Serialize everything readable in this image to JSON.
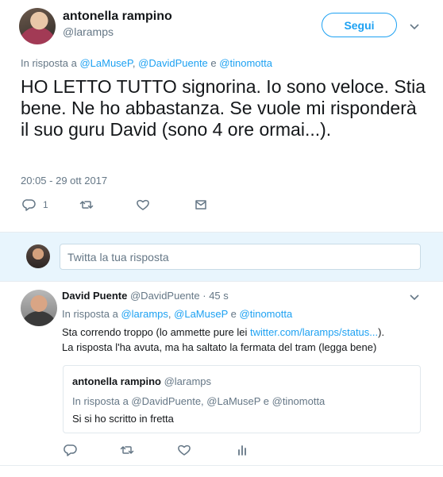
{
  "main_tweet": {
    "author_name": "antonella rampino",
    "author_handle": "@laramps",
    "follow_label": "Segui",
    "reply_prefix": "In risposta a",
    "reply_users": [
      "@LaMuseP",
      "@DavidPuente",
      "@tinomotta"
    ],
    "reply_sep": ",",
    "reply_and": "e",
    "text": "HO LETTO TUTTO signorina. Io sono veloce. Stia bene. Ne ho abbastanza. Se vuole mi risponderà il suo guru David (sono 4 ore ormai...).",
    "timestamp": "20:05 - 29 ott 2017",
    "reply_count": "1"
  },
  "reply_box": {
    "placeholder": "Twitta la tua risposta"
  },
  "reply_tweet": {
    "author_name": "David Puente",
    "author_handle": "@DavidPuente",
    "time_ago": "· 45 s",
    "reply_prefix": "In risposta a",
    "reply_users": [
      "@laramps",
      "@LaMuseP",
      "@tinomotta"
    ],
    "reply_and": "e",
    "text_before_link": "Sta correndo troppo (lo ammette pure lei ",
    "link": "twitter.com/laramps/status...",
    "text_after_link": "). La risposta l'ha avuta, ma ha saltato la fermata del tram (legga bene)",
    "quote": {
      "author_name": "antonella rampino",
      "author_handle": "@laramps",
      "reply_line": "In risposta a @DavidPuente, @LaMuseP e @tinomotta",
      "text": "Si si ho scritto in fretta"
    }
  },
  "colors": {
    "accent": "#1da1f2",
    "muted": "#657786",
    "reply_bg": "#e8f5fd"
  },
  "icons": [
    "chevron-down-icon",
    "reply-icon",
    "retweet-icon",
    "like-icon",
    "message-icon",
    "analytics-icon"
  ]
}
